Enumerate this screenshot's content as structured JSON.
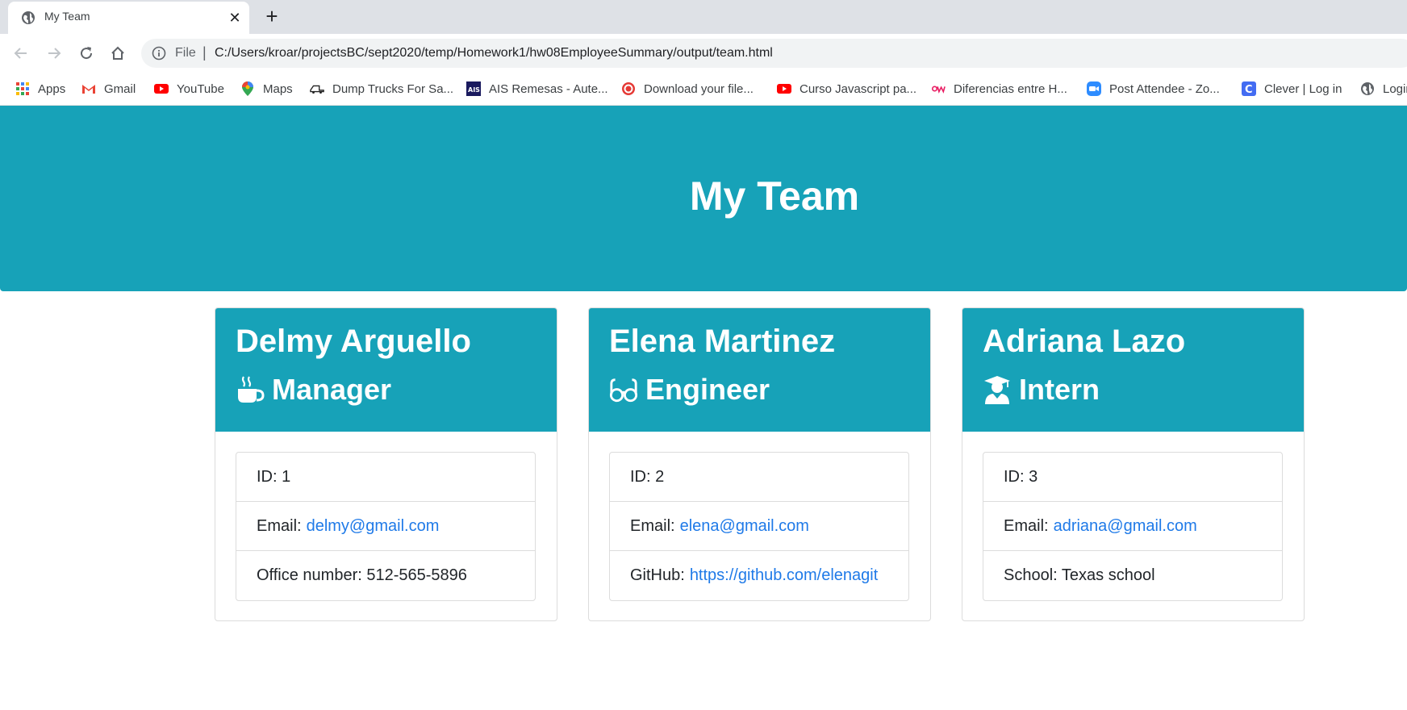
{
  "browser": {
    "tab_title": "My Team",
    "close_glyph": "✕",
    "new_tab_glyph": "+",
    "url_scheme": "File",
    "url_separator": "|",
    "url": "C:/Users/kroar/projectsBC/sept2020/temp/Homework1/hw08EmployeeSummary/output/team.html",
    "bookmarks": [
      {
        "label": "Apps",
        "icon": "apps-grid-icon"
      },
      {
        "label": "Gmail",
        "icon": "gmail-icon"
      },
      {
        "label": "YouTube",
        "icon": "youtube-icon"
      },
      {
        "label": "Maps",
        "icon": "maps-pin-icon"
      },
      {
        "label": "Dump Trucks For Sa...",
        "icon": "truck-icon"
      },
      {
        "label": "AIS Remesas - Aute...",
        "icon": "ais-icon"
      },
      {
        "label": "Download your file...",
        "icon": "download-icon"
      },
      {
        "label": "Curso Javascript pa...",
        "icon": "youtube-icon"
      },
      {
        "label": "Diferencias entre H...",
        "icon": "ow-icon"
      },
      {
        "label": "Post Attendee - Zo...",
        "icon": "zoom-icon"
      },
      {
        "label": "Clever | Log in",
        "icon": "clever-icon"
      },
      {
        "label": "Login",
        "icon": "globe-icon"
      }
    ]
  },
  "page": {
    "title": "My Team"
  },
  "employees": [
    {
      "name": "Delmy Arguello",
      "role": "Manager",
      "role_icon": "coffee-mug-icon",
      "id_label": "ID: 1",
      "email_label": "Email:",
      "email": "delmy@gmail.com",
      "extra_label": "Office number: 512-565-5896"
    },
    {
      "name": "Elena Martinez",
      "role": "Engineer",
      "role_icon": "glasses-icon",
      "id_label": "ID: 2",
      "email_label": "Email:",
      "email": "elena@gmail.com",
      "extra_label": "GitHub:",
      "extra_link": "https://github.com/elenagit"
    },
    {
      "name": "Adriana Lazo",
      "role": "Intern",
      "role_icon": "graduate-icon",
      "id_label": "ID: 3",
      "email_label": "Email:",
      "email": "adriana@gmail.com",
      "extra_label": "School: Texas school"
    }
  ],
  "colors": {
    "header_bg": "#17a2b8",
    "link": "#1f7ae8",
    "tabstrip": "#dee1e6"
  }
}
